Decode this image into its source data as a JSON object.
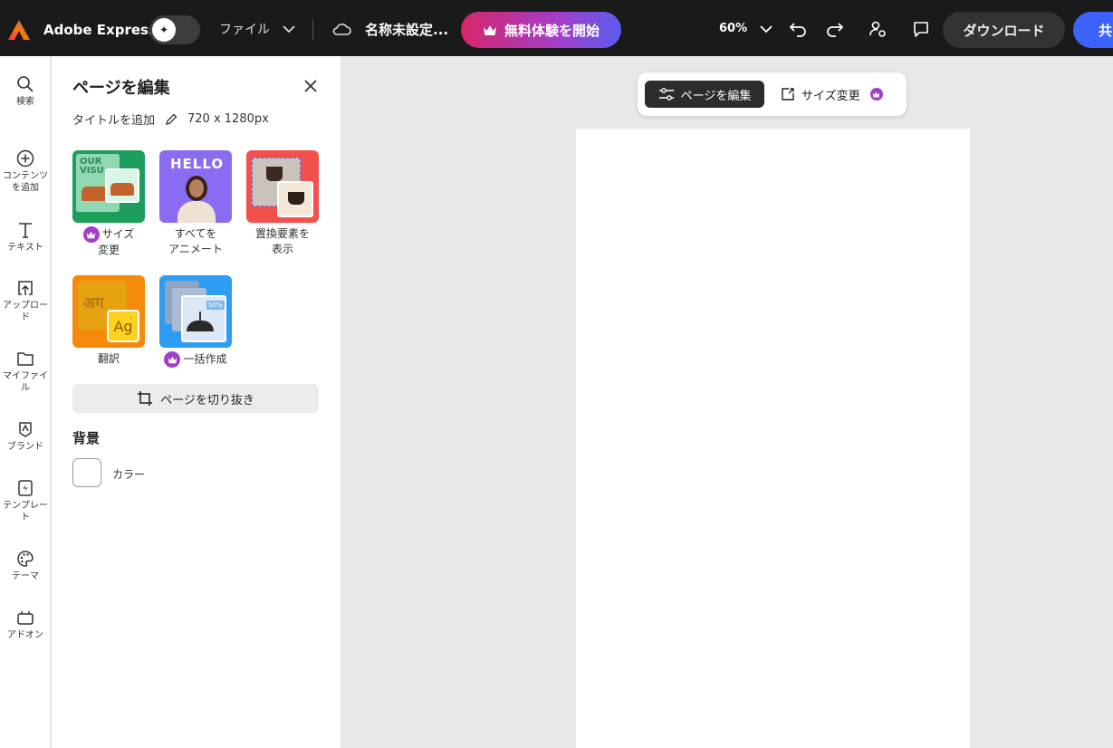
{
  "topbar": {
    "app_name": "Adobe Express",
    "file_menu": "ファイル",
    "doc_title": "名称未設定...",
    "trial_button": "無料体験を開始",
    "zoom": "60%",
    "download_button": "ダウンロード",
    "share_button": "共"
  },
  "rail": {
    "items": [
      {
        "label": "検索",
        "icon": "search-icon"
      },
      {
        "label": "コンテンツ\nを追加",
        "icon": "plus-circle-icon"
      },
      {
        "label": "テキスト",
        "icon": "text-icon"
      },
      {
        "label": "アップロー\nド",
        "icon": "upload-icon"
      },
      {
        "label": "マイファイ\nル",
        "icon": "folder-icon"
      },
      {
        "label": "ブランド",
        "icon": "brand-icon"
      },
      {
        "label": "テンプレー\nト",
        "icon": "template-icon"
      },
      {
        "label": "テーマ",
        "icon": "palette-icon"
      },
      {
        "label": "アドオン",
        "icon": "addon-icon"
      }
    ]
  },
  "panel": {
    "title": "ページを編集",
    "add_title": "タイトルを追加",
    "dimensions": "720 x 1280px",
    "tiles": [
      {
        "label": "サイズ\n変更",
        "premium": true
      },
      {
        "label": "すべてを\nアニメート",
        "premium": false
      },
      {
        "label": "置換要素を\n表示",
        "premium": false
      },
      {
        "label": "翻訳",
        "premium": false
      },
      {
        "label": "一括作成",
        "premium": true
      }
    ],
    "tile_art": {
      "resize_text": "OUR VISU",
      "animate_text": "HELLO",
      "translate_hindi": "अग",
      "translate_latin": "Ag",
      "bulk_badge": "50%"
    },
    "crop_button": "ページを切り抜き",
    "background_heading": "背景",
    "color_label": "カラー"
  },
  "canvas": {
    "edit_page_button": "ページを編集",
    "resize_button": "サイズ変更"
  },
  "colors": {
    "topbar_bg": "#1a1a1a",
    "trial_gradient_start": "#d6266a",
    "trial_gradient_end": "#5b5cf0",
    "share_blue": "#3b63fb",
    "premium_purple": "#a23ec8",
    "canvas_bg": "#e8e8e8"
  }
}
